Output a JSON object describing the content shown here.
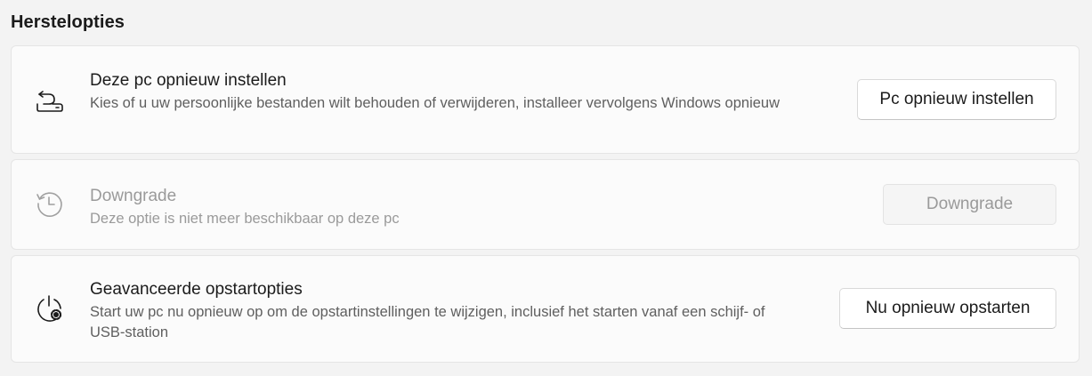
{
  "section": {
    "title": "Herstelopties"
  },
  "options": [
    {
      "icon": "reset-pc-icon",
      "title": "Deze pc opnieuw instellen",
      "description": "Kies of u uw persoonlijke bestanden wilt behouden of verwijderen, installeer vervolgens Windows opnieuw",
      "button_label": "Pc opnieuw instellen",
      "enabled": true
    },
    {
      "icon": "history-icon",
      "title": "Downgrade",
      "description": "Deze optie is niet meer beschikbaar op deze pc",
      "button_label": "Downgrade",
      "enabled": false
    },
    {
      "icon": "advanced-startup-icon",
      "title": "Geavanceerde opstartopties",
      "description": "Start uw pc nu opnieuw op om de opstartinstellingen te wijzigen, inclusief het starten vanaf een schijf- of USB-station",
      "button_label": "Nu opnieuw opstarten",
      "enabled": true
    }
  ],
  "colors": {
    "background": "#f3f3f3",
    "card": "#fbfbfb",
    "text_primary": "#1b1b1b",
    "text_secondary": "#5f5f5f",
    "text_disabled": "#9a9a9a"
  }
}
